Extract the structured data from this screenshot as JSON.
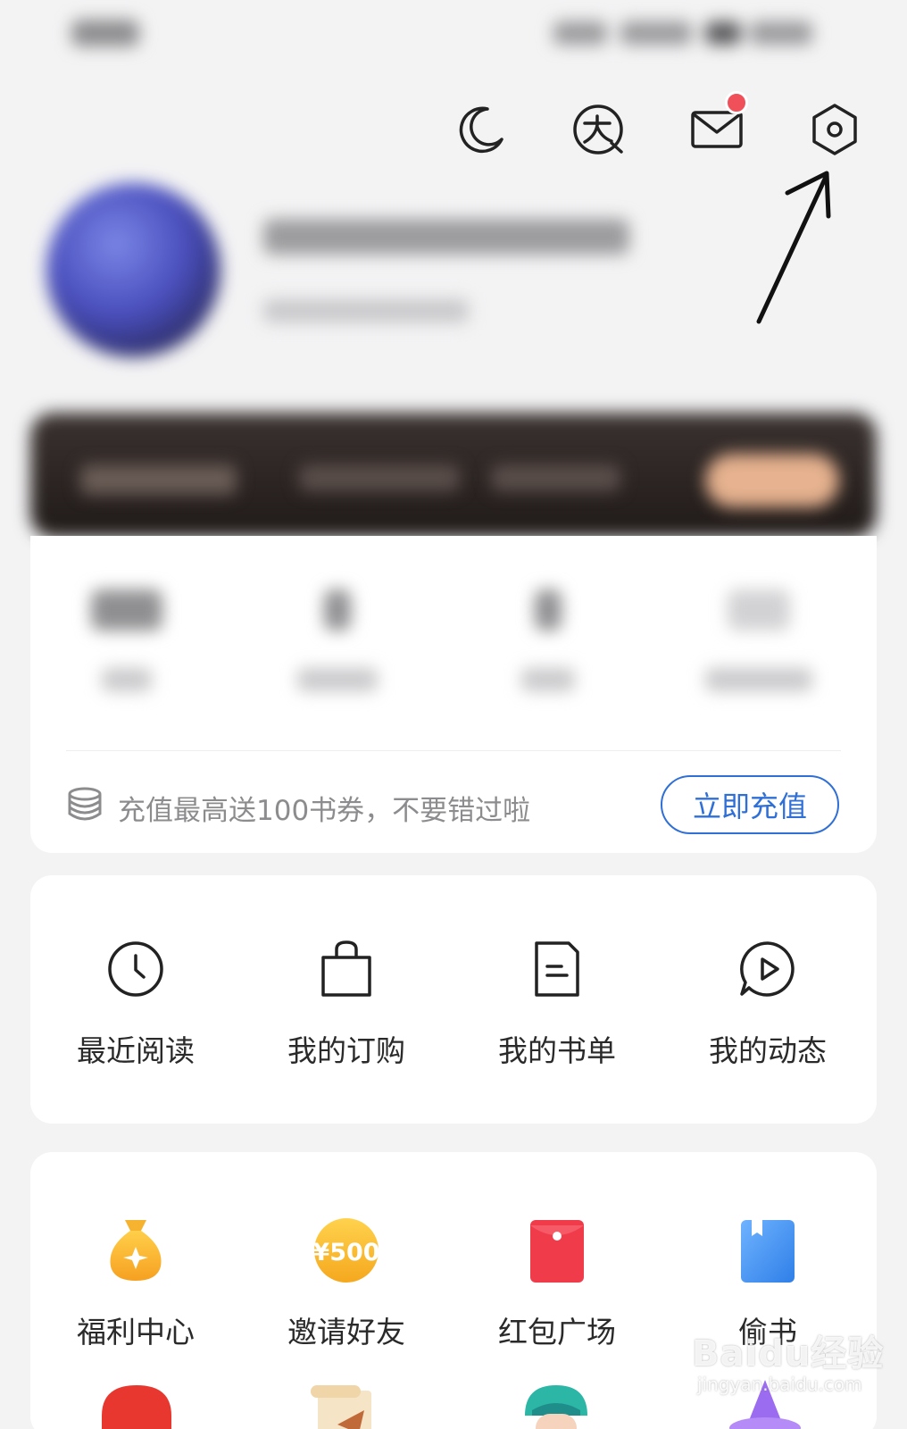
{
  "header": {
    "icons": [
      "moon-icon",
      "font-size-icon",
      "mail-icon",
      "settings-icon"
    ],
    "mail_has_unread": true
  },
  "recharge": {
    "promo_text": "充值最高送100书券，不要错过啦",
    "button_label": "立即充值"
  },
  "menu": {
    "items": [
      {
        "label": "最近阅读",
        "icon": "clock-icon"
      },
      {
        "label": "我的订购",
        "icon": "shopping-bag-icon"
      },
      {
        "label": "我的书单",
        "icon": "document-icon"
      },
      {
        "label": "我的动态",
        "icon": "play-bubble-icon"
      }
    ]
  },
  "benefits": {
    "items": [
      {
        "label": "福利中心",
        "icon": "money-bag-icon"
      },
      {
        "label": "邀请好友",
        "icon": "coin-500-icon",
        "badge": "¥500"
      },
      {
        "label": "红包广场",
        "icon": "red-envelope-icon"
      },
      {
        "label": "偷书",
        "icon": "blue-book-icon"
      }
    ]
  },
  "watermark": {
    "main": "Baidu经验",
    "sub": "jingyan.baidu.com"
  },
  "colors": {
    "accent_blue": "#2f6fd6",
    "badge_red": "#f0505a",
    "background": "#f3f3f4"
  }
}
